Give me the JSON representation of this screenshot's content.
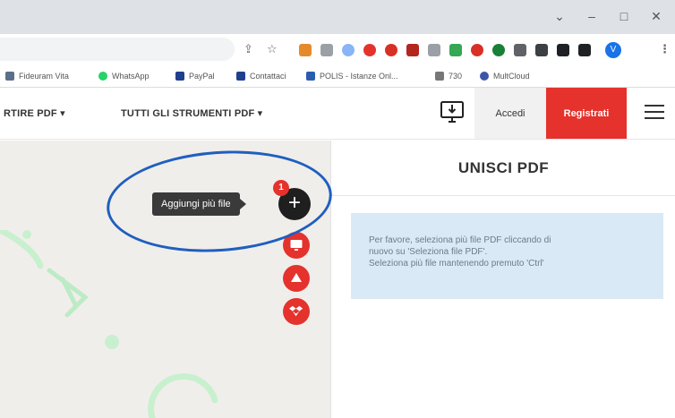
{
  "window": {
    "controls": {
      "minimize": "–",
      "restore": "□",
      "close": "✕",
      "tab_dropdown": "⌄"
    }
  },
  "browser_toolbar": {
    "icons": [
      "share-icon",
      "star-icon",
      "extension-icons",
      "profile-icon",
      "menu-icon"
    ],
    "menu_glyph": "⋮",
    "profile_letter": "V"
  },
  "bookmarks": [
    {
      "label": "Fideuram Vita",
      "color": "#5b6f8a"
    },
    {
      "label": "WhatsApp",
      "color": "#25d366"
    },
    {
      "label": "PayPal",
      "color": "#1f3f8f"
    },
    {
      "label": "Contattaci",
      "color": "#1f3f8f"
    },
    {
      "label": "POLIS - Istanze Onl...",
      "color": "#2a5db0"
    },
    {
      "label": "730",
      "color": "#777777"
    },
    {
      "label": "MultCloud",
      "color": "#3b56a8"
    }
  ],
  "site_header": {
    "nav": [
      {
        "label": "RTIRE PDF ▾"
      },
      {
        "label": "TUTTI GLI STRUMENTI PDF ▾"
      }
    ],
    "login_label": "Accedi",
    "signup_label": "Registrati",
    "accent_color": "#e5322d"
  },
  "workspace": {
    "tooltip": "Aggiungi più file",
    "add_button_glyph": "+",
    "file_count_badge": "1",
    "upload_sources": [
      "computer-icon",
      "google-drive-icon",
      "dropbox-icon"
    ]
  },
  "sidebar": {
    "title": "UNISCI PDF",
    "info_line_1": "Per favore, seleziona più file PDF cliccando di",
    "info_line_2": "nuovo su 'Seleziona file PDF'.",
    "info_line_3": "Seleziona più file mantenendo premuto 'Ctrl'"
  }
}
